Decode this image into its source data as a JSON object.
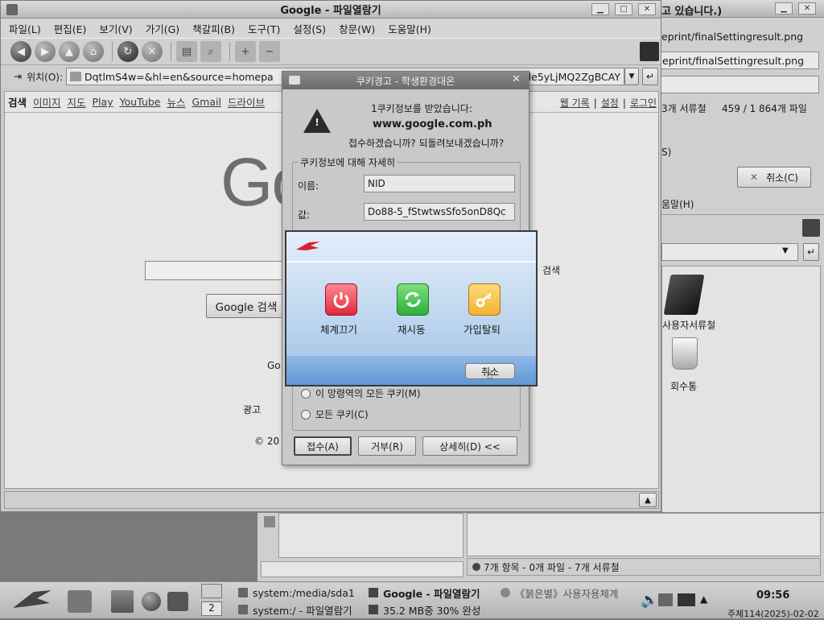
{
  "browser": {
    "title": "Google - 파일열람기",
    "menu": [
      "파일(L)",
      "편집(E)",
      "보기(V)",
      "가기(G)",
      "책갈피(B)",
      "도구(T)",
      "설정(S)",
      "창문(W)",
      "도움말(H)"
    ],
    "location_label": "위치(O):",
    "location_value": "DqtlmS4w=&hl=en&source=homepa",
    "location_tail": "de5yLjMQ2ZgBCAY"
  },
  "google": {
    "nav": [
      "검색",
      "이미지",
      "지도",
      "Play",
      "YouTube",
      "뉴스",
      "Gmail",
      "드라이브"
    ],
    "right_links": [
      "웹 기록",
      "설정",
      "로그인"
    ],
    "logo_partial": "Go",
    "search_button": "Google 검색",
    "side_search": "검색",
    "go_partial": "Go",
    "ad": "광고",
    "copyright": "© 20"
  },
  "back_window": {
    "title_fragment": "고 있습니다.)",
    "path1": "eprint/finalSettingresult.png",
    "path2": "eprint/finalSettingresult.png",
    "stats_folders": "3개 서류철",
    "stats_files": "459 / 1 864개 파일",
    "fragment_s": "S)",
    "cancel": "취소(C)",
    "help_fragment": "움말(H)"
  },
  "file_manager": {
    "icon_user_folder": "사용자서류철",
    "icon_trash": "회수통",
    "status": "7개 항목 - 0개 파일 - 7개 서류철"
  },
  "cookie_dialog": {
    "title": "쿠키경고 - 학생환경대온",
    "received": "1쿠키정보를 받았습니다:",
    "domain": "www.google.com.ph",
    "question": "접수하겠습니까? 되돌려보내겠습니까?",
    "details_legend": "쿠키정보에 대해 자세히",
    "name_label": "이름:",
    "name_value": "NID",
    "value_label": "값:",
    "value_value": "Do88-5_fStwtwsSfo5onD8Qc",
    "option_domain": "이 망령역의 모든 쿠키(M)",
    "option_all": "모든 쿠키(C)",
    "accept": "접수(A)",
    "reject": "거부(R)",
    "details_toggle": "상세히(D) <<"
  },
  "logout_dialog": {
    "shutdown": "체계끄기",
    "restart": "재시동",
    "logout": "가입탈퇴",
    "cancel": "취소"
  },
  "taskbar": {
    "desktop_number": "2",
    "tasks": [
      "system:/media/sda1",
      "Google - 파일열람기",
      "《붉은별》사용자용체계",
      "system:/ - 파일열람기",
      "35.2 MB중 30% 완성"
    ],
    "clock": "09:56",
    "date": "주체114(2025)-02-02"
  },
  "colors": {
    "red_button": "#e02a3a",
    "green_button": "#2eae3a",
    "orange_button": "#f2b233",
    "dialog_blue": "#b9d3ec"
  }
}
